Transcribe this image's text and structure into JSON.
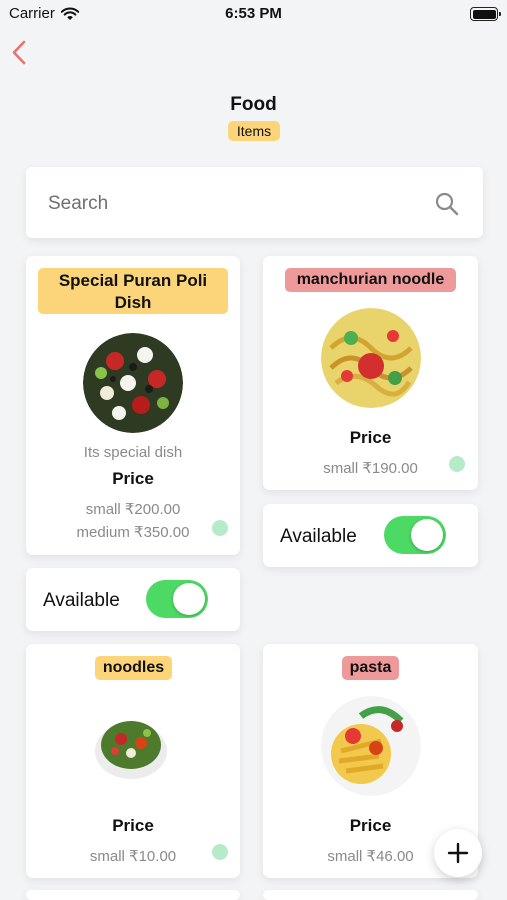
{
  "status_bar": {
    "carrier": "Carrier",
    "time": "6:53 PM"
  },
  "header": {
    "title": "Food",
    "badge": "Items"
  },
  "search": {
    "placeholder": "Search"
  },
  "items": [
    {
      "name": "Special Puran Poli Dish",
      "description": "Its special dish",
      "price_label": "Price",
      "prices": [
        "small ₹200.00",
        "medium ₹350.00"
      ],
      "availability_label": "Available",
      "available": true
    },
    {
      "name": "manchurian noodle",
      "price_label": "Price",
      "prices": [
        "small ₹190.00"
      ],
      "availability_label": "Available",
      "available": true
    },
    {
      "name": "noodles",
      "price_label": "Price",
      "prices": [
        "small ₹10.00"
      ]
    },
    {
      "name": "pasta",
      "price_label": "Price",
      "prices": [
        "small ₹46.00"
      ]
    }
  ],
  "colors": {
    "accent_back": "#e8736d",
    "tag_yellow": "#fcd57a",
    "tag_pink": "#ef9a9a",
    "toggle_on": "#4cd964",
    "status_dot": "#b6ebc9"
  },
  "icons": [
    "wifi-icon",
    "battery-icon",
    "back-chevron-icon",
    "search-icon",
    "plus-icon"
  ]
}
